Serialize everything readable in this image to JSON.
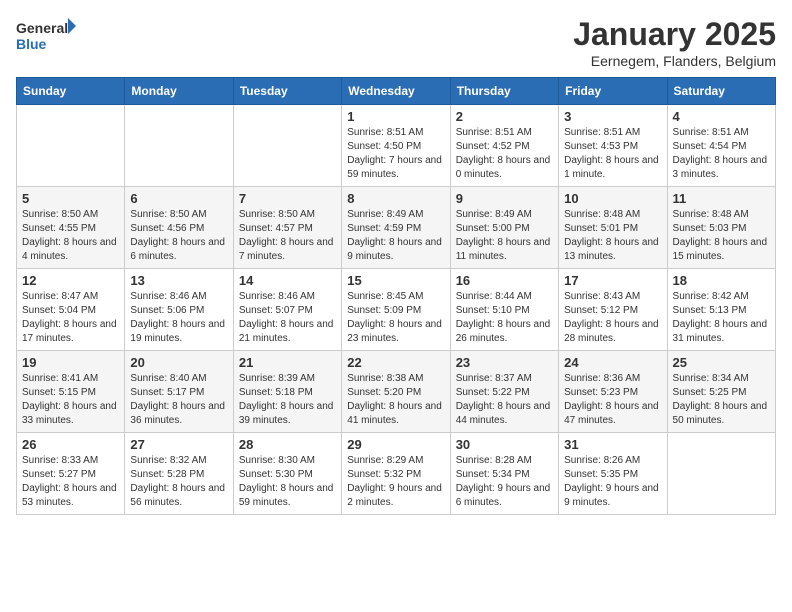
{
  "logo": {
    "text_general": "General",
    "text_blue": "Blue"
  },
  "title": "January 2025",
  "subtitle": "Eernegem, Flanders, Belgium",
  "days_of_week": [
    "Sunday",
    "Monday",
    "Tuesday",
    "Wednesday",
    "Thursday",
    "Friday",
    "Saturday"
  ],
  "weeks": [
    [
      {
        "day": "",
        "detail": ""
      },
      {
        "day": "",
        "detail": ""
      },
      {
        "day": "",
        "detail": ""
      },
      {
        "day": "1",
        "detail": "Sunrise: 8:51 AM\nSunset: 4:50 PM\nDaylight: 7 hours and 59 minutes."
      },
      {
        "day": "2",
        "detail": "Sunrise: 8:51 AM\nSunset: 4:52 PM\nDaylight: 8 hours and 0 minutes."
      },
      {
        "day": "3",
        "detail": "Sunrise: 8:51 AM\nSunset: 4:53 PM\nDaylight: 8 hours and 1 minute."
      },
      {
        "day": "4",
        "detail": "Sunrise: 8:51 AM\nSunset: 4:54 PM\nDaylight: 8 hours and 3 minutes."
      }
    ],
    [
      {
        "day": "5",
        "detail": "Sunrise: 8:50 AM\nSunset: 4:55 PM\nDaylight: 8 hours and 4 minutes."
      },
      {
        "day": "6",
        "detail": "Sunrise: 8:50 AM\nSunset: 4:56 PM\nDaylight: 8 hours and 6 minutes."
      },
      {
        "day": "7",
        "detail": "Sunrise: 8:50 AM\nSunset: 4:57 PM\nDaylight: 8 hours and 7 minutes."
      },
      {
        "day": "8",
        "detail": "Sunrise: 8:49 AM\nSunset: 4:59 PM\nDaylight: 8 hours and 9 minutes."
      },
      {
        "day": "9",
        "detail": "Sunrise: 8:49 AM\nSunset: 5:00 PM\nDaylight: 8 hours and 11 minutes."
      },
      {
        "day": "10",
        "detail": "Sunrise: 8:48 AM\nSunset: 5:01 PM\nDaylight: 8 hours and 13 minutes."
      },
      {
        "day": "11",
        "detail": "Sunrise: 8:48 AM\nSunset: 5:03 PM\nDaylight: 8 hours and 15 minutes."
      }
    ],
    [
      {
        "day": "12",
        "detail": "Sunrise: 8:47 AM\nSunset: 5:04 PM\nDaylight: 8 hours and 17 minutes."
      },
      {
        "day": "13",
        "detail": "Sunrise: 8:46 AM\nSunset: 5:06 PM\nDaylight: 8 hours and 19 minutes."
      },
      {
        "day": "14",
        "detail": "Sunrise: 8:46 AM\nSunset: 5:07 PM\nDaylight: 8 hours and 21 minutes."
      },
      {
        "day": "15",
        "detail": "Sunrise: 8:45 AM\nSunset: 5:09 PM\nDaylight: 8 hours and 23 minutes."
      },
      {
        "day": "16",
        "detail": "Sunrise: 8:44 AM\nSunset: 5:10 PM\nDaylight: 8 hours and 26 minutes."
      },
      {
        "day": "17",
        "detail": "Sunrise: 8:43 AM\nSunset: 5:12 PM\nDaylight: 8 hours and 28 minutes."
      },
      {
        "day": "18",
        "detail": "Sunrise: 8:42 AM\nSunset: 5:13 PM\nDaylight: 8 hours and 31 minutes."
      }
    ],
    [
      {
        "day": "19",
        "detail": "Sunrise: 8:41 AM\nSunset: 5:15 PM\nDaylight: 8 hours and 33 minutes."
      },
      {
        "day": "20",
        "detail": "Sunrise: 8:40 AM\nSunset: 5:17 PM\nDaylight: 8 hours and 36 minutes."
      },
      {
        "day": "21",
        "detail": "Sunrise: 8:39 AM\nSunset: 5:18 PM\nDaylight: 8 hours and 39 minutes."
      },
      {
        "day": "22",
        "detail": "Sunrise: 8:38 AM\nSunset: 5:20 PM\nDaylight: 8 hours and 41 minutes."
      },
      {
        "day": "23",
        "detail": "Sunrise: 8:37 AM\nSunset: 5:22 PM\nDaylight: 8 hours and 44 minutes."
      },
      {
        "day": "24",
        "detail": "Sunrise: 8:36 AM\nSunset: 5:23 PM\nDaylight: 8 hours and 47 minutes."
      },
      {
        "day": "25",
        "detail": "Sunrise: 8:34 AM\nSunset: 5:25 PM\nDaylight: 8 hours and 50 minutes."
      }
    ],
    [
      {
        "day": "26",
        "detail": "Sunrise: 8:33 AM\nSunset: 5:27 PM\nDaylight: 8 hours and 53 minutes."
      },
      {
        "day": "27",
        "detail": "Sunrise: 8:32 AM\nSunset: 5:28 PM\nDaylight: 8 hours and 56 minutes."
      },
      {
        "day": "28",
        "detail": "Sunrise: 8:30 AM\nSunset: 5:30 PM\nDaylight: 8 hours and 59 minutes."
      },
      {
        "day": "29",
        "detail": "Sunrise: 8:29 AM\nSunset: 5:32 PM\nDaylight: 9 hours and 2 minutes."
      },
      {
        "day": "30",
        "detail": "Sunrise: 8:28 AM\nSunset: 5:34 PM\nDaylight: 9 hours and 6 minutes."
      },
      {
        "day": "31",
        "detail": "Sunrise: 8:26 AM\nSunset: 5:35 PM\nDaylight: 9 hours and 9 minutes."
      },
      {
        "day": "",
        "detail": ""
      }
    ]
  ]
}
